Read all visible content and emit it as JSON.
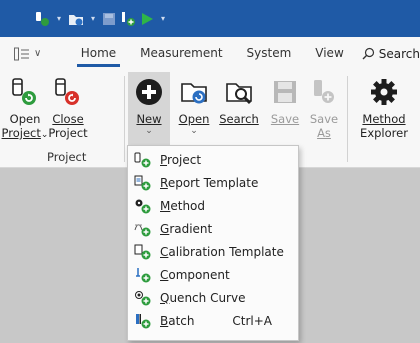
{
  "quick_access": [
    {
      "icon": "open-project-icon",
      "dropdown": true
    },
    {
      "icon": "open-folder-icon",
      "dropdown": true
    },
    {
      "icon": "save-icon",
      "dropdown": false
    },
    {
      "icon": "add-batch-icon",
      "dropdown": false
    },
    {
      "icon": "run-icon",
      "dropdown": true
    }
  ],
  "tabs": {
    "home": "Home",
    "measurement": "Measurement",
    "system": "System",
    "view": "View"
  },
  "search": {
    "label": "Search"
  },
  "ribbon": {
    "open_project": {
      "line1": "Open",
      "line2": "Project"
    },
    "close_project": {
      "line1": "Close",
      "line2": "Project"
    },
    "new": {
      "line1": "New"
    },
    "open": {
      "line1": "Open"
    },
    "search": {
      "line1": "Search"
    },
    "save": {
      "line1": "Save"
    },
    "save_as": {
      "line1": "Save",
      "line2": "As"
    },
    "method_explorer": {
      "line1": "Method",
      "line2": "Explorer"
    },
    "project_group": "Project"
  },
  "new_menu": {
    "items": [
      {
        "key": "P",
        "rest": "roject",
        "icon": "project-icon",
        "shortcut": ""
      },
      {
        "key": "R",
        "rest": "eport Template",
        "icon": "report-template-icon",
        "shortcut": ""
      },
      {
        "key": "M",
        "rest": "ethod",
        "icon": "method-icon",
        "shortcut": ""
      },
      {
        "key": "G",
        "rest": "radient",
        "icon": "gradient-icon",
        "shortcut": ""
      },
      {
        "key": "C",
        "rest": "alibration Template",
        "icon": "calibration-template-icon",
        "shortcut": ""
      },
      {
        "key": "C",
        "rest": "omponent",
        "icon": "component-icon",
        "shortcut": ""
      },
      {
        "key": "Q",
        "rest": "uench Curve",
        "icon": "quench-curve-icon",
        "shortcut": ""
      },
      {
        "key": "B",
        "rest": "atch",
        "icon": "batch-icon",
        "shortcut": "Ctrl+A"
      }
    ]
  },
  "colors": {
    "title_bar": "#1f5aa6",
    "accent_green": "#2e9c3e",
    "accent_red": "#d7312a"
  }
}
